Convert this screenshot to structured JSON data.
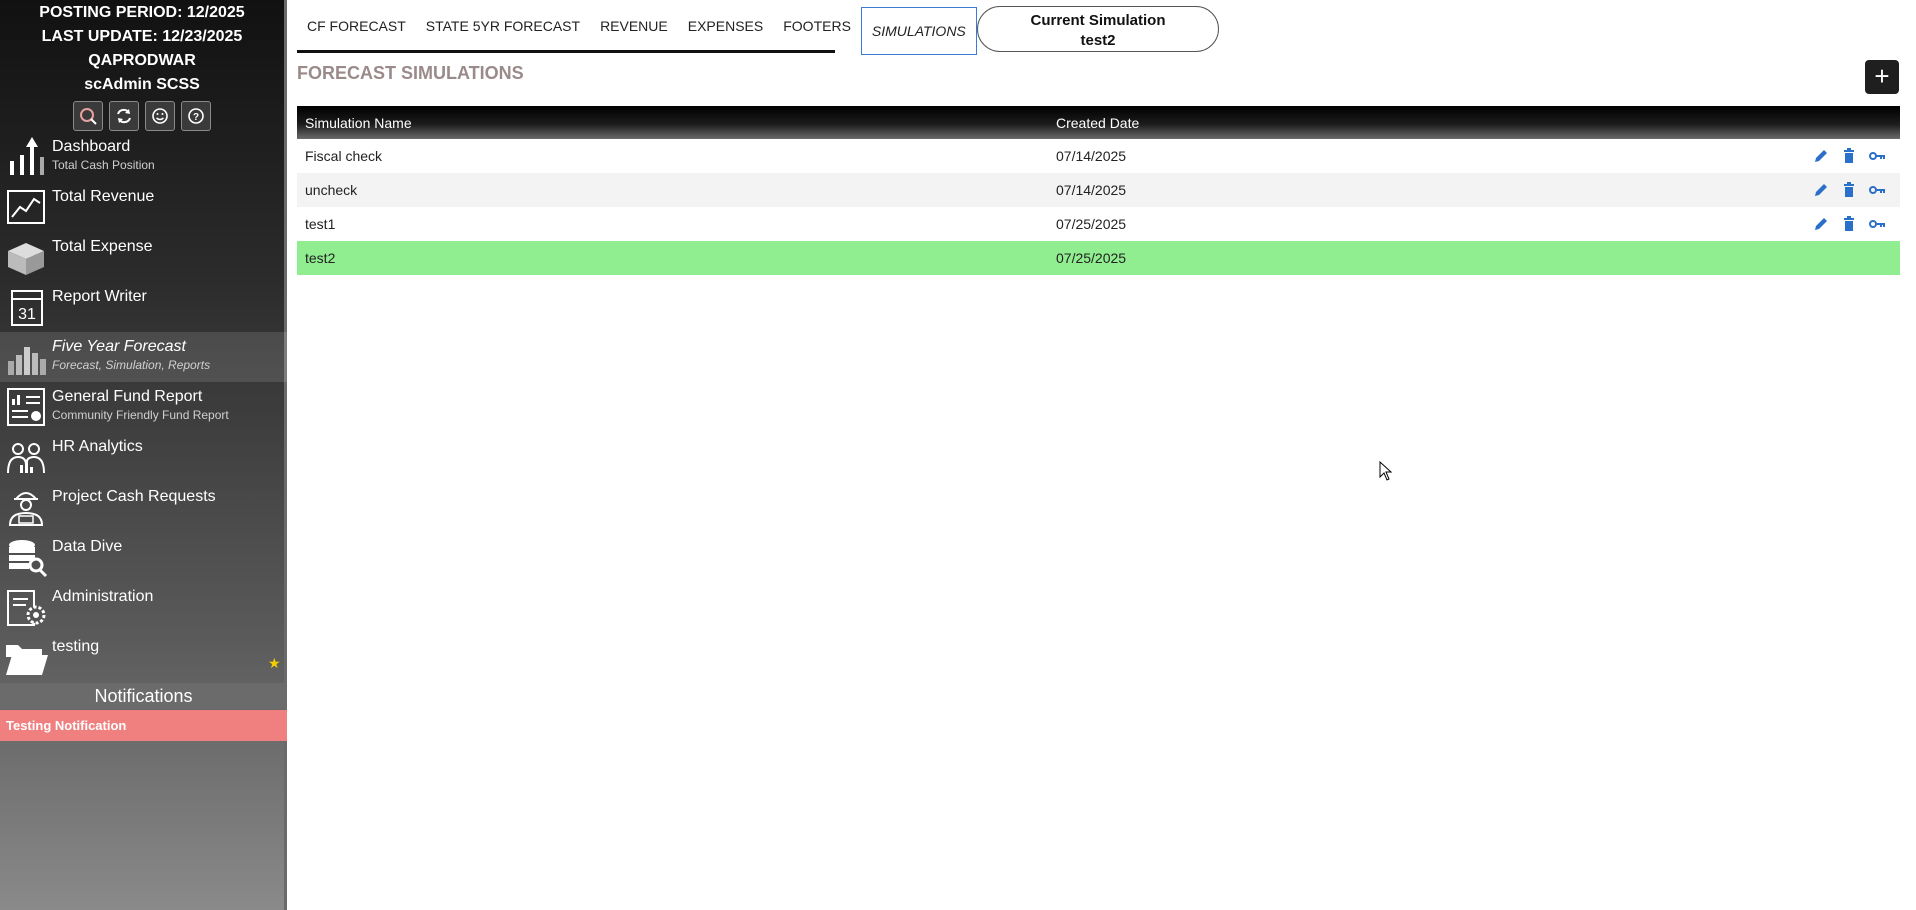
{
  "sidebar": {
    "header": {
      "posting_period": "POSTING PERIOD: 12/2025",
      "last_update": "LAST UPDATE: 12/23/2025",
      "environment": "QAPRODWAR",
      "user": "scAdmin SCSS"
    },
    "tools": [
      {
        "icon": "search-icon"
      },
      {
        "icon": "refresh-icon"
      },
      {
        "icon": "smiley-icon"
      },
      {
        "icon": "help-icon"
      }
    ],
    "items": [
      {
        "title": "Dashboard",
        "subtitle": "Total Cash Position",
        "icon": "dashboard-arrows-icon"
      },
      {
        "title": "Total Revenue",
        "subtitle": "",
        "icon": "revenue-chart-icon"
      },
      {
        "title": "Total Expense",
        "subtitle": "",
        "icon": "expense-box-icon"
      },
      {
        "title": "Report Writer",
        "subtitle": "",
        "icon": "calendar-icon"
      },
      {
        "title": "Five Year Forecast",
        "subtitle": "Forecast, Simulation, Reports",
        "icon": "forecast-bars-icon"
      },
      {
        "title": "General Fund Report",
        "subtitle": "Community Friendly Fund Report",
        "icon": "fund-report-icon"
      },
      {
        "title": "HR Analytics",
        "subtitle": "",
        "icon": "people-icon"
      },
      {
        "title": "Project Cash Requests",
        "subtitle": "",
        "icon": "worker-icon"
      },
      {
        "title": "Data Dive",
        "subtitle": "",
        "icon": "database-search-icon"
      },
      {
        "title": "Administration",
        "subtitle": "",
        "icon": "admin-gear-icon"
      },
      {
        "title": "testing",
        "subtitle": "",
        "icon": "folder-icon"
      }
    ],
    "notifications": {
      "title": "Notifications",
      "items": [
        "Testing Notification"
      ]
    }
  },
  "tabs": [
    "CF FORECAST",
    "STATE 5YR FORECAST",
    "REVENUE",
    "EXPENSES",
    "FOOTERS",
    "SIMULATIONS"
  ],
  "active_tab": "SIMULATIONS",
  "current_simulation": {
    "label": "Current Simulation",
    "value": "test2"
  },
  "page": {
    "title": "FORECAST SIMULATIONS",
    "add_button": "+"
  },
  "table": {
    "columns": [
      "Simulation Name",
      "Created Date"
    ],
    "rows": [
      {
        "name": "Fiscal check",
        "date": "07/14/2025",
        "actions": [
          "edit-icon",
          "delete-icon",
          "key-icon"
        ]
      },
      {
        "name": "uncheck",
        "date": "07/14/2025",
        "actions": [
          "edit-icon",
          "delete-icon",
          "key-icon"
        ]
      },
      {
        "name": "test1",
        "date": "07/25/2025",
        "actions": [
          "edit-icon",
          "delete-icon",
          "key-icon"
        ]
      },
      {
        "name": "test2",
        "date": "07/25/2025",
        "actions": []
      }
    ]
  },
  "colors": {
    "selected_row": "#90ee90",
    "notification_bg": "#f08080",
    "action_icon": "#2a6fc9",
    "active_tab_border": "#3a7bd5"
  }
}
